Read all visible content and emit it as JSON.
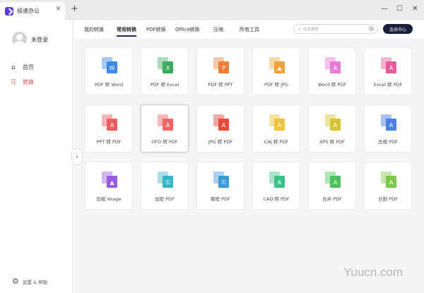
{
  "window": {
    "tab_title": "极速办公",
    "tab_close": "✕",
    "new_tab": "+",
    "minimize": "—",
    "maximize": "☐",
    "close": "✕"
  },
  "sidebar": {
    "username": "未登录",
    "items": [
      {
        "label": "首页",
        "icon": "home-icon"
      },
      {
        "label": "转换",
        "icon": "convert-icon"
      }
    ],
    "settings_label": "设置 & 帮助",
    "collapse_glyph": "‹"
  },
  "topnav": {
    "tabs": [
      "我的转换",
      "常用转换",
      "PDF转换",
      "Office转换",
      "压缩",
      "所有工具"
    ],
    "active_index": 1,
    "search_placeholder": "在此搜索",
    "vip_button": "会员中心"
  },
  "tools": [
    {
      "label": "PDF 转 Word",
      "front": "#3e86ea",
      "back": "#a6c8f4",
      "glyph": "W",
      "icon": "pdf-to-word-icon"
    },
    {
      "label": "PDF 转 Excel",
      "front": "#3aaa5c",
      "back": "#a8dcb8",
      "glyph": "X",
      "icon": "pdf-to-excel-icon"
    },
    {
      "label": "PDF 转 PPT",
      "front": "#f07c3a",
      "back": "#f8c8a8",
      "glyph": "P",
      "icon": "pdf-to-ppt-icon"
    },
    {
      "label": "PDF 转 JPG",
      "front": "#f0a23a",
      "back": "#f8d8a8",
      "glyph": "▲",
      "icon": "pdf-to-jpg-icon"
    },
    {
      "label": "Word 转 PDF",
      "front": "#e87ad8",
      "back": "#f4bfea",
      "glyph": "A",
      "icon": "word-to-pdf-icon"
    },
    {
      "label": "Excel 转 PDF",
      "front": "#e85a9a",
      "back": "#f4b4d0",
      "glyph": "A",
      "icon": "excel-to-pdf-icon"
    },
    {
      "label": "PPT 转 PDF",
      "front": "#ee5c5c",
      "back": "#f7b3b3",
      "glyph": "A",
      "icon": "ppt-to-pdf-icon"
    },
    {
      "label": "OFD 转 PDF",
      "front": "#f06666",
      "back": "#f8b8b8",
      "glyph": "A",
      "icon": "ofd-to-pdf-icon"
    },
    {
      "label": "JPG 转 PDF",
      "front": "#e84a3a",
      "back": "#f4aaa2",
      "glyph": "A",
      "icon": "jpg-to-pdf-icon"
    },
    {
      "label": "CAJ 转 PDF",
      "front": "#f0c23a",
      "back": "#f8e2a0",
      "glyph": "A",
      "icon": "caj-to-pdf-icon"
    },
    {
      "label": "XPS 转 PDF",
      "front": "#d8c22e",
      "back": "#ece29a",
      "glyph": "A",
      "icon": "xps-to-pdf-icon"
    },
    {
      "label": "压缩 PDF",
      "front": "#4a7ee8",
      "back": "#a8c2f4",
      "glyph": "A",
      "icon": "compress-pdf-icon"
    },
    {
      "label": "压缩 Image",
      "front": "#9a5ae0",
      "back": "#d2b4f2",
      "glyph": "▲",
      "icon": "compress-image-icon"
    },
    {
      "label": "加密 PDF",
      "front": "#3ab4c8",
      "back": "#a8dce6",
      "glyph": "⚿",
      "icon": "encrypt-pdf-icon"
    },
    {
      "label": "解密 PDF",
      "front": "#3a9ad8",
      "back": "#a8d0ee",
      "glyph": "⚿",
      "icon": "decrypt-pdf-icon"
    },
    {
      "label": "CAD 转 PDF",
      "front": "#3ac28a",
      "back": "#a8e4ca",
      "glyph": "A",
      "icon": "cad-to-pdf-icon"
    },
    {
      "label": "合并 PDF",
      "front": "#4ac25a",
      "back": "#ace4b4",
      "glyph": "A",
      "icon": "merge-pdf-icon"
    },
    {
      "label": "分割 PDF",
      "front": "#7ac84a",
      "back": "#c4e6ac",
      "glyph": "A",
      "icon": "split-pdf-icon"
    }
  ],
  "selected_tool_index": 7,
  "watermark": "Yuucn.com"
}
